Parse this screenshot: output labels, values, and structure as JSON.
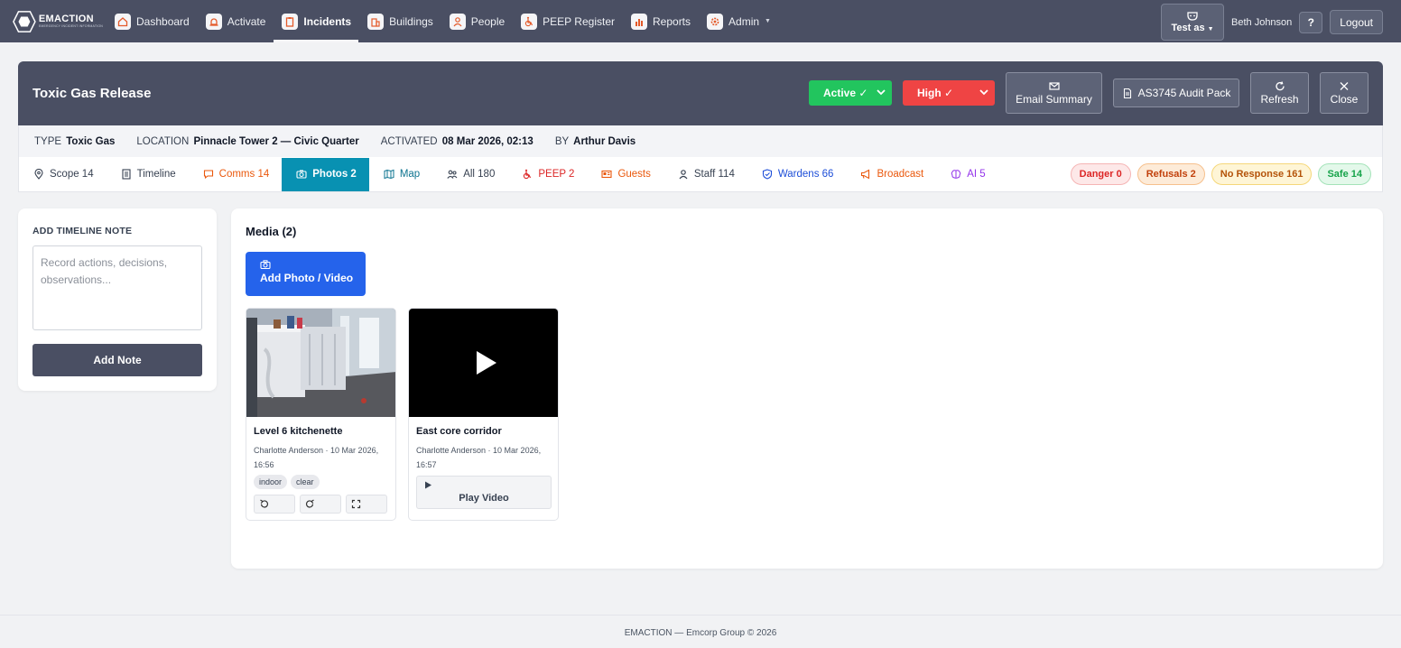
{
  "nav": {
    "logo_name": "EMACTION",
    "logo_sub": "EMERGENCY INCIDENT INFORMATION",
    "items": [
      {
        "label": "Dashboard",
        "icon": "home-icon"
      },
      {
        "label": "Activate",
        "icon": "alarm-icon"
      },
      {
        "label": "Incidents",
        "icon": "clipboard-icon"
      },
      {
        "label": "Buildings",
        "icon": "building-icon"
      },
      {
        "label": "People",
        "icon": "person-icon"
      },
      {
        "label": "PEEP Register",
        "icon": "wheelchair-icon"
      },
      {
        "label": "Reports",
        "icon": "chart-icon"
      },
      {
        "label": "Admin",
        "icon": "gear-icon"
      }
    ],
    "active_item": "Incidents",
    "test_as": "Test as",
    "user": "Beth Johnson",
    "help": "?",
    "logout": "Logout"
  },
  "incident": {
    "title": "Toxic Gas Release",
    "status": "Active ✓",
    "priority": "High ✓",
    "buttons": {
      "email": "Email Summary",
      "audit": "AS3745 Audit Pack",
      "refresh": "Refresh",
      "close": "Close"
    },
    "meta": {
      "type_label": "TYPE",
      "type": "Toxic Gas",
      "location_label": "LOCATION",
      "location": "Pinnacle Tower 2 — Civic Quarter",
      "activated_label": "ACTIVATED",
      "activated": "08 Mar 2026, 02:13",
      "by_label": "BY",
      "by": "Arthur Davis"
    }
  },
  "tabs": [
    {
      "label": "Scope 14",
      "icon": "pin-icon",
      "color": "#374151"
    },
    {
      "label": "Timeline",
      "icon": "list-icon",
      "color": "#374151"
    },
    {
      "label": "Comms 14",
      "icon": "chat-icon",
      "color": "#ea580c"
    },
    {
      "label": "Photos 2",
      "icon": "camera-icon",
      "color": "#ffffff"
    },
    {
      "label": "Map",
      "icon": "map-icon",
      "color": "#0e7490"
    },
    {
      "label": "All 180",
      "icon": "people-icon",
      "color": "#374151"
    },
    {
      "label": "PEEP 2",
      "icon": "wheelchair-icon",
      "color": "#dc2626"
    },
    {
      "label": "Guests",
      "icon": "id-card-icon",
      "color": "#ea580c"
    },
    {
      "label": "Staff 114",
      "icon": "person-icon",
      "color": "#374151"
    },
    {
      "label": "Wardens 66",
      "icon": "shield-icon",
      "color": "#1d4ed8"
    },
    {
      "label": "Broadcast",
      "icon": "megaphone-icon",
      "color": "#ea580c"
    },
    {
      "label": "AI 5",
      "icon": "brain-icon",
      "color": "#9333ea"
    }
  ],
  "active_tab": "Photos 2",
  "badges": [
    {
      "label": "Danger 0",
      "bg": "#fde8e8",
      "border": "#f5b5b5",
      "color": "#dc2626"
    },
    {
      "label": "Refusals 2",
      "bg": "#fdebd8",
      "border": "#f6c08d",
      "color": "#c2410c"
    },
    {
      "label": "No Response 161",
      "bg": "#fef5d6",
      "border": "#f5d77a",
      "color": "#b45309"
    },
    {
      "label": "Safe 14",
      "bg": "#e3f8ea",
      "border": "#a4e3b9",
      "color": "#16a34a"
    }
  ],
  "note_panel": {
    "label": "ADD TIMELINE NOTE",
    "placeholder": "Record actions, decisions, observations...",
    "button": "Add Note"
  },
  "media": {
    "title": "Media (2)",
    "add_button": "Add Photo / Video",
    "items": [
      {
        "title": "Level 6 kitchenette",
        "meta": "Charlotte Anderson · 10 Mar 2026, 16:56",
        "tags": [
          "indoor",
          "clear"
        ],
        "type": "photo"
      },
      {
        "title": "East core corridor",
        "meta": "Charlotte Anderson · 10 Mar 2026, 16:57",
        "tags": [],
        "type": "video",
        "play_label": "Play Video"
      }
    ]
  },
  "footer": "EMACTION — Emcorp Group © 2026"
}
